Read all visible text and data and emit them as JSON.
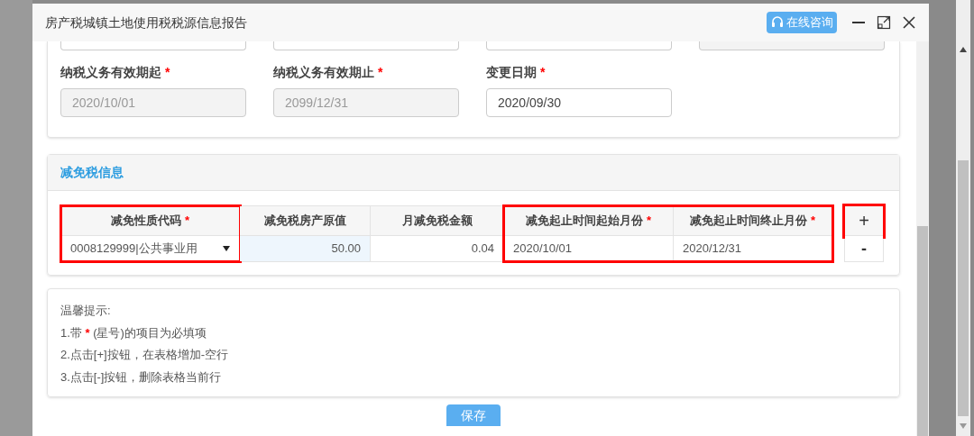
{
  "window": {
    "title": "房产税城镇土地使用税税源信息报告",
    "consult_button": "在线咨询"
  },
  "period_fields": [
    {
      "label": "纳税义务有效期起",
      "required": true,
      "value": "2020/10/01",
      "disabled": true
    },
    {
      "label": "纳税义务有效期止",
      "required": true,
      "value": "2099/12/31",
      "disabled": true
    },
    {
      "label": "变更日期",
      "required": true,
      "value": "2020/09/30",
      "disabled": false
    }
  ],
  "relief_section": {
    "title": "减免税信息",
    "column_groups": [
      {
        "highlighted": true,
        "columns": [
          {
            "header": "减免性质代码",
            "required": true,
            "kind": "select",
            "focused": false,
            "value": "0008129999|公共事业用"
          }
        ]
      },
      {
        "highlighted": false,
        "columns": [
          {
            "header": "减免税房产原值",
            "required": false,
            "kind": "number",
            "focused": true,
            "value": "50.00"
          },
          {
            "header": "月减免税金额",
            "required": false,
            "kind": "number",
            "focused": false,
            "value": "0.04"
          }
        ]
      },
      {
        "highlighted": true,
        "columns": [
          {
            "header": "减免起止时间起始月份",
            "required": true,
            "kind": "date",
            "focused": false,
            "value": "2020/10/01"
          },
          {
            "header": "减免起止时间终止月份",
            "required": true,
            "kind": "date",
            "focused": false,
            "value": "2020/12/31"
          }
        ]
      }
    ],
    "add_button": {
      "label": "+",
      "highlighted": true
    },
    "remove_button": "-"
  },
  "tips": {
    "title": "温馨提示:",
    "lines": [
      {
        "parts": [
          {
            "kind": "plain",
            "text": "1.带 "
          },
          {
            "kind": "required",
            "text": "*"
          },
          {
            "kind": "plain",
            "text": " (星号)的项目为必填项"
          }
        ]
      },
      {
        "parts": [
          {
            "kind": "plain",
            "text": "2.点击[+]按钮，在表格增加-空行"
          }
        ]
      },
      {
        "parts": [
          {
            "kind": "plain",
            "text": "3.点击[-]按钮，删除表格当前行"
          }
        ]
      }
    ]
  },
  "save_button": "保存"
}
